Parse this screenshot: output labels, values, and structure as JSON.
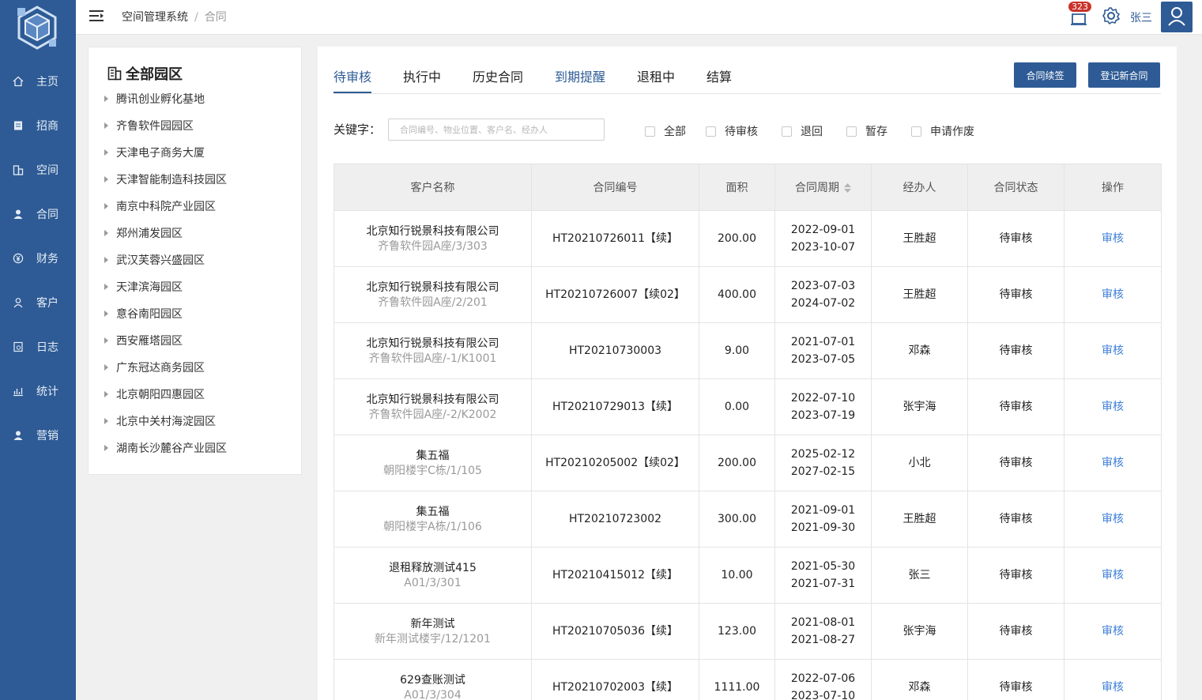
{
  "nav": {
    "items": [
      {
        "label": "主页",
        "icon": "home-icon"
      },
      {
        "label": "招商",
        "icon": "document-icon"
      },
      {
        "label": "空间",
        "icon": "building-icon"
      },
      {
        "label": "合同",
        "icon": "user-icon"
      },
      {
        "label": "财务",
        "icon": "currency-icon"
      },
      {
        "label": "客户",
        "icon": "person-icon"
      },
      {
        "label": "日志",
        "icon": "log-icon"
      },
      {
        "label": "统计",
        "icon": "chart-icon"
      },
      {
        "label": "营销",
        "icon": "user-icon"
      }
    ]
  },
  "header": {
    "breadcrumb_root": "空间管理系统",
    "breadcrumb_sep": "/",
    "breadcrumb_current": "合同",
    "notification_count": "323",
    "username": "张三"
  },
  "parks": {
    "title": "全部园区",
    "items": [
      "腾讯创业孵化基地",
      "齐鲁软件园园区",
      "天津电子商务大厦",
      "天津智能制造科技园区",
      "南京中科院产业园区",
      "郑州浦发园区",
      "武汉芙蓉兴盛园区",
      "天津滨海园区",
      "意谷南阳园区",
      "西安雁塔园区",
      "广东冠达商务园区",
      "北京朝阳四惠园区",
      "北京中关村海淀园区",
      "湖南长沙麓谷产业园区"
    ]
  },
  "tabs": [
    "待审核",
    "执行中",
    "历史合同",
    "到期提醒",
    "退租中",
    "结算"
  ],
  "buttons": {
    "renew": "合同续签",
    "register": "登记新合同"
  },
  "filter": {
    "keyword_label": "关键字：",
    "keyword_placeholder": "合同编号、物业位置、客户名、经办人",
    "options": [
      "全部",
      "待审核",
      "退回",
      "暂存",
      "申请作废"
    ]
  },
  "table": {
    "columns": [
      "客户名称",
      "合同编号",
      "面积",
      "合同周期",
      "经办人",
      "合同状态",
      "操作"
    ],
    "rows": [
      {
        "customer": "北京知行锐景科技有限公司",
        "location": "齐鲁软件园A座/3/303",
        "contract_no": "HT20210726011【续】",
        "area": "200.00",
        "start": "2022-09-01",
        "end": "2023-10-07",
        "agent": "王胜超",
        "status": "待审核",
        "action": "审核"
      },
      {
        "customer": "北京知行锐景科技有限公司",
        "location": "齐鲁软件园A座/2/201",
        "contract_no": "HT20210726007【续02】",
        "area": "400.00",
        "start": "2023-07-03",
        "end": "2024-07-02",
        "agent": "王胜超",
        "status": "待审核",
        "action": "审核"
      },
      {
        "customer": "北京知行锐景科技有限公司",
        "location": "齐鲁软件园A座/-1/K1001",
        "contract_no": "HT20210730003",
        "area": "9.00",
        "start": "2021-07-01",
        "end": "2023-07-05",
        "agent": "邓森",
        "status": "待审核",
        "action": "审核"
      },
      {
        "customer": "北京知行锐景科技有限公司",
        "location": "齐鲁软件园A座/-2/K2002",
        "contract_no": "HT20210729013【续】",
        "area": "0.00",
        "start": "2022-07-10",
        "end": "2023-07-19",
        "agent": "张宇海",
        "status": "待审核",
        "action": "审核"
      },
      {
        "customer": "集五福",
        "location": "朝阳楼宇C栋/1/105",
        "contract_no": "HT20210205002【续02】",
        "area": "200.00",
        "start": "2025-02-12",
        "end": "2027-02-15",
        "agent": "小北",
        "status": "待审核",
        "action": "审核"
      },
      {
        "customer": "集五福",
        "location": "朝阳楼宇A栋/1/106",
        "contract_no": "HT20210723002",
        "area": "300.00",
        "start": "2021-09-01",
        "end": "2021-09-30",
        "agent": "王胜超",
        "status": "待审核",
        "action": "审核"
      },
      {
        "customer": "退租释放测试415",
        "location": "A01/3/301",
        "contract_no": "HT20210415012【续】",
        "area": "10.00",
        "start": "2021-05-30",
        "end": "2021-07-31",
        "agent": "张三",
        "status": "待审核",
        "action": "审核"
      },
      {
        "customer": "新年测试",
        "location": "新年测试楼宇/12/1201",
        "contract_no": "HT20210705036【续】",
        "area": "123.00",
        "start": "2021-08-01",
        "end": "2021-08-27",
        "agent": "张宇海",
        "status": "待审核",
        "action": "审核"
      },
      {
        "customer": "629查账测试",
        "location": "A01/3/304",
        "contract_no": "HT20210702003【续】",
        "area": "1111.00",
        "start": "2022-07-06",
        "end": "2023-07-10",
        "agent": "邓森",
        "status": "待审核",
        "action": "审核"
      }
    ]
  },
  "colors": {
    "primary": "#2e5b95",
    "link": "#3d7fd6",
    "badge": "#c9332b"
  }
}
